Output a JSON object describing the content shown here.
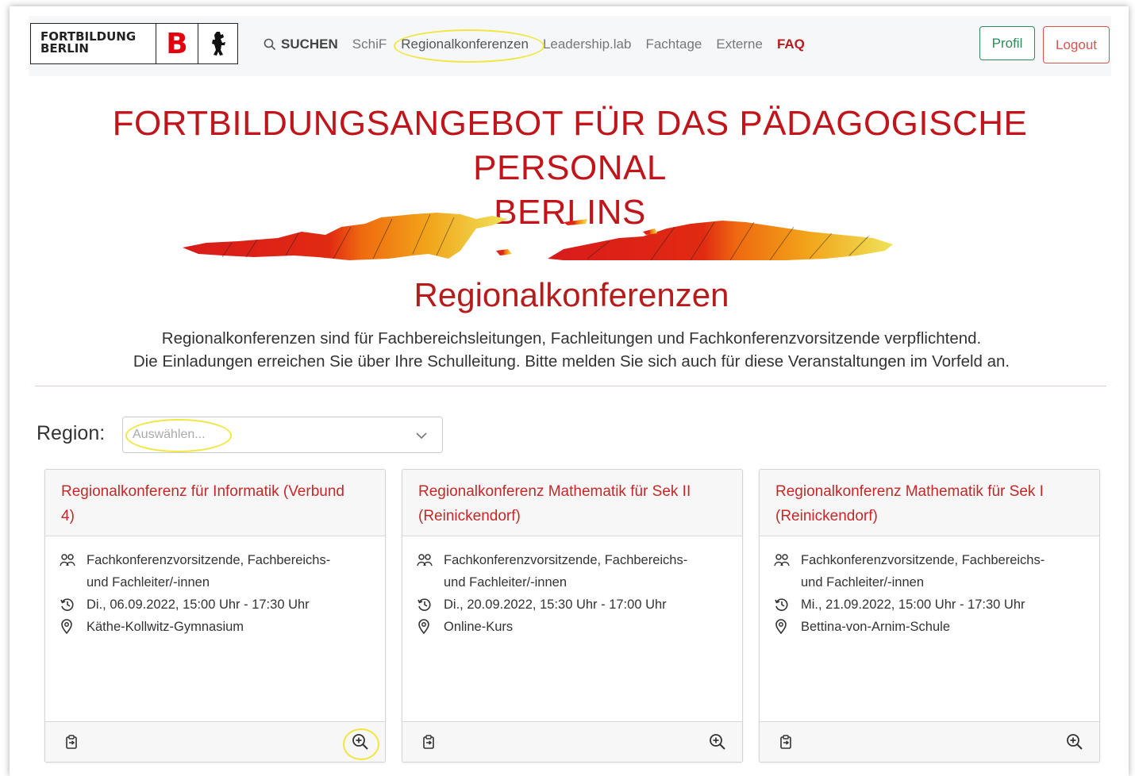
{
  "header": {
    "logo_text_line1": "FORTBILDUNG",
    "logo_text_line2": "BERLIN",
    "logo_letter": "B",
    "nav": {
      "search": "SUCHEN",
      "schif": "SchiF",
      "regionalkonferenzen": "Regionalkonferenzen",
      "leadership": "Leadership.lab",
      "fachtage": "Fachtage",
      "externe": "Externe",
      "faq": "FAQ"
    },
    "profil": "Profil",
    "logout": "Logout"
  },
  "main": {
    "title_line1": "FORTBILDUNGSANGEBOT FÜR DAS PÄDAGOGISCHE PERSONAL",
    "title_line2": "BERLINS",
    "subtitle": "Regionalkonferenzen",
    "desc_line1": "Regionalkonferenzen sind für Fachbereichsleitungen, Fachleitungen und Fachkonferenzvorsitzende verpflichtend.",
    "desc_line2": "Die Einladungen erreichen Sie über Ihre Schulleitung. Bitte melden Sie sich auch für diese Veranstaltungen im Vorfeld an."
  },
  "filter": {
    "label": "Region:",
    "placeholder": "Auswählen..."
  },
  "cards": [
    {
      "title_line1": "Regionalkonferenz für Informatik (Verbund",
      "title_line2": "4)",
      "audience_line1": "Fachkonferenzvorsitzende, Fachbereichs-",
      "audience_line2": "und Fachleiter/-innen",
      "datetime": "Di., 06.09.2022, 15:00 Uhr - 17:30 Uhr",
      "location": "Käthe-Kollwitz-Gymnasium"
    },
    {
      "title_line1": "Regionalkonferenz Mathematik für Sek II",
      "title_line2": "(Reinickendorf)",
      "audience_line1": "Fachkonferenzvorsitzende, Fachbereichs-",
      "audience_line2": "und Fachleiter/-innen",
      "datetime": "Di., 20.09.2022, 15:30 Uhr - 17:00 Uhr",
      "location": "Online-Kurs"
    },
    {
      "title_line1": "Regionalkonferenz Mathematik für Sek I",
      "title_line2": "(Reinickendorf)",
      "audience_line1": "Fachkonferenzvorsitzende, Fachbereichs-",
      "audience_line2": "und Fachleiter/-innen",
      "datetime": "Mi., 21.09.2022, 15:00 Uhr - 17:30 Uhr",
      "location": "Bettina-von-Arnim-Schule"
    }
  ],
  "colors": {
    "brand_red": "#c0151b",
    "highlight_yellow": "#f2e642",
    "profil_green": "#2e8b57",
    "logout_red": "#d9534f"
  },
  "icons": {
    "nav_search": "search-icon",
    "audience": "people-icon",
    "datetime": "history-clock-icon",
    "location": "map-pin-icon",
    "footer_left": "clipboard-icon",
    "footer_right": "zoom-in-icon"
  }
}
